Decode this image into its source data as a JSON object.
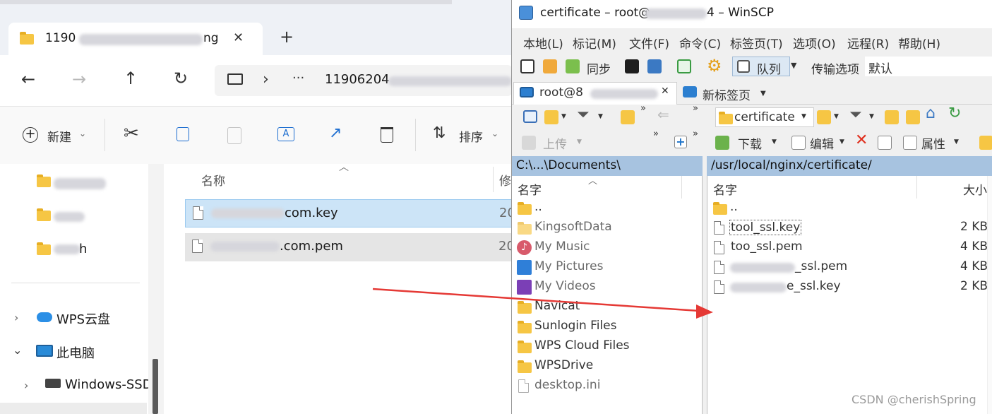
{
  "explorer": {
    "tab_title_prefix": "1190",
    "tab_title_suffix": "ng",
    "close_glyph": "✕",
    "new_tab_glyph": "+",
    "address_more": "···",
    "address_chevron": "›",
    "address_path_prefix": "11906204",
    "new_label": "新建",
    "sort_label": "排序",
    "column_name": "名称",
    "column_modified": "修",
    "files": [
      {
        "suffix": "com.key",
        "date": "20"
      },
      {
        "suffix": ".com.pem",
        "date": "20"
      }
    ],
    "sidebar_tail": "h",
    "wps_cloud": "WPS云盘",
    "this_pc": "此电脑",
    "windows_ssd": "Windows-SSD"
  },
  "winscp": {
    "title_prefix": "certificate – root@",
    "title_suffix": "4 – WinSCP",
    "menu": [
      "本地(L)",
      "标记(M)",
      "文件(F)",
      "命令(C)",
      "标签页(T)",
      "选项(O)",
      "远程(R)",
      "帮助(H)"
    ],
    "sync_label": "同步",
    "queue_label": "队列",
    "transfer_options_label": "传输选项",
    "transfer_default": "默认",
    "session_tab_prefix": "root@8",
    "new_tab_label": "新标签页",
    "remote_dir_combo": "certificate",
    "upload_label": "上传",
    "download_label": "下载",
    "edit_label": "编辑",
    "properties_label": "属性",
    "local_path": "C:\\...\\Documents\\",
    "remote_path": "/usr/local/nginx/certificate/",
    "local_col_name": "名字",
    "remote_col_name": "名字",
    "remote_col_size": "大小",
    "local_items": [
      {
        "name": "..",
        "type": "parent"
      },
      {
        "name": "KingsoftData",
        "type": "folder-grey"
      },
      {
        "name": "My Music",
        "type": "music"
      },
      {
        "name": "My Pictures",
        "type": "pictures"
      },
      {
        "name": "My Videos",
        "type": "videos"
      },
      {
        "name": "Navicat",
        "type": "folder"
      },
      {
        "name": "Sunlogin Files",
        "type": "folder"
      },
      {
        "name": "WPS Cloud Files",
        "type": "folder"
      },
      {
        "name": "WPSDrive",
        "type": "folder"
      },
      {
        "name": "desktop.ini",
        "type": "ini"
      }
    ],
    "remote_items": [
      {
        "name": "..",
        "size": ""
      },
      {
        "name": "tool_ssl.key",
        "size": "2 KB"
      },
      {
        "name": "too_ssl.pem",
        "size": "4 KB"
      },
      {
        "name": "_ssl.pem",
        "size": "4 KB"
      },
      {
        "name": "e_ssl.key",
        "size": "2 KB"
      }
    ]
  },
  "watermark": "CSDN @cherishSpring",
  "colors": {
    "accent": "#0067c0",
    "path_bar": "#a7c3e0",
    "selection": "#cce4f7",
    "arrow": "#e53935"
  }
}
